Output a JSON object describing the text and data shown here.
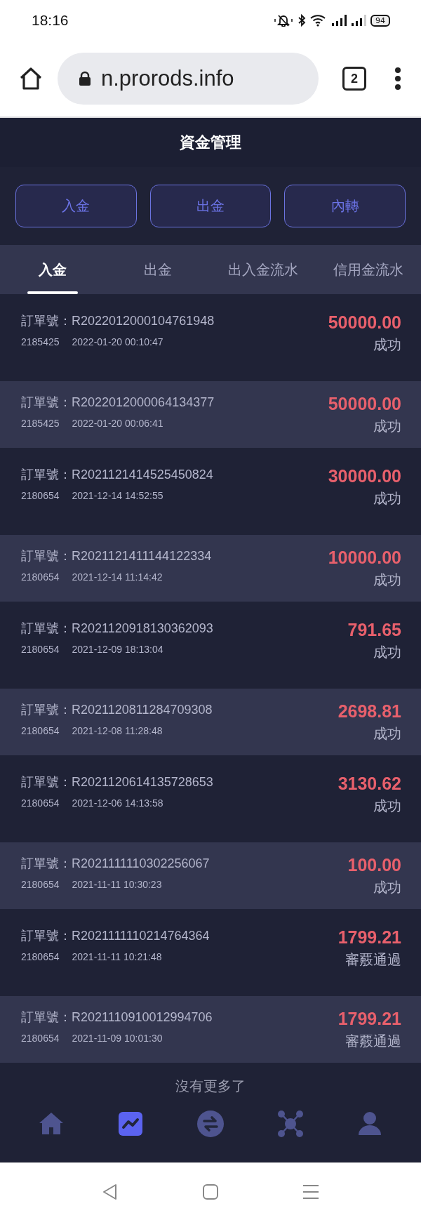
{
  "status_bar": {
    "time": "18:16",
    "battery": "94"
  },
  "browser": {
    "url": "n.prorods.info",
    "tab_count": "2"
  },
  "header": {
    "title": "資金管理"
  },
  "action_buttons": [
    "入金",
    "出金",
    "內轉"
  ],
  "tabs": [
    {
      "label": "入金",
      "selected": true
    },
    {
      "label": "出金",
      "selected": false
    },
    {
      "label": "出入金流水",
      "selected": false
    },
    {
      "label": "信用金流水",
      "selected": false
    }
  ],
  "records": [
    {
      "order": "訂單號：R2022012000104761948",
      "user": "2185425",
      "time": "2022-01-20 00:10:47",
      "amount": "50000.00",
      "status": "成功"
    },
    {
      "order": "訂單號：R2022012000064134377",
      "user": "2185425",
      "time": "2022-01-20 00:06:41",
      "amount": "50000.00",
      "status": "成功"
    },
    {
      "order": "訂單號：R2021121414525450824",
      "user": "2180654",
      "time": "2021-12-14 14:52:55",
      "amount": "30000.00",
      "status": "成功"
    },
    {
      "order": "訂單號：R2021121411144122334",
      "user": "2180654",
      "time": "2021-12-14 11:14:42",
      "amount": "10000.00",
      "status": "成功"
    },
    {
      "order": "訂單號：R2021120918130362093",
      "user": "2180654",
      "time": "2021-12-09 18:13:04",
      "amount": "791.65",
      "status": "成功"
    },
    {
      "order": "訂單號：R2021120811284709308",
      "user": "2180654",
      "time": "2021-12-08 11:28:48",
      "amount": "2698.81",
      "status": "成功"
    },
    {
      "order": "訂單號：R2021120614135728653",
      "user": "2180654",
      "time": "2021-12-06 14:13:58",
      "amount": "3130.62",
      "status": "成功"
    },
    {
      "order": "訂單號：R2021111110302256067",
      "user": "2180654",
      "time": "2021-11-11 10:30:23",
      "amount": "100.00",
      "status": "成功"
    },
    {
      "order": "訂單號：R2021111110214764364",
      "user": "2180654",
      "time": "2021-11-11 10:21:48",
      "amount": "1799.21",
      "status": "審覈通過"
    },
    {
      "order": "訂單號：R2021110910012994706",
      "user": "2180654",
      "time": "2021-11-09 10:01:30",
      "amount": "1799.21",
      "status": "審覈通過"
    }
  ],
  "list_end": "沒有更多了",
  "bottom_nav": [
    {
      "selected": false
    },
    {
      "selected": true
    },
    {
      "selected": false
    },
    {
      "selected": false
    },
    {
      "selected": false
    }
  ]
}
